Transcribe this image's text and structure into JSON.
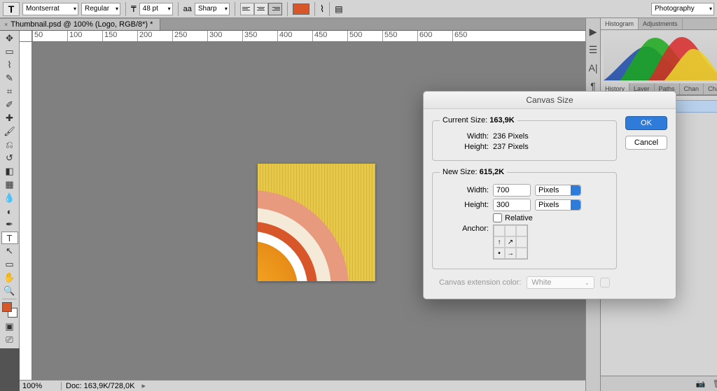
{
  "options_bar": {
    "tool_letter": "T",
    "font_family": "Montserrat",
    "font_style": "Regular",
    "font_size": "48 pt",
    "aa_label": "aa",
    "aa_mode": "Sharp",
    "text_color": "#d8572a",
    "workspace": "Photography"
  },
  "doc_tab": {
    "title": "Thumbnail.psd @ 100% (Logo, RGB/8*) *"
  },
  "ruler_ticks": [
    "50",
    "100",
    "150",
    "200",
    "250",
    "300",
    "350",
    "400",
    "450",
    "500",
    "550",
    "600",
    "650"
  ],
  "status_bar": {
    "zoom": "100%",
    "doc_size": "Doc: 163,9K/728,0K"
  },
  "panels": {
    "hist_tabs": [
      "Histogram",
      "Adjustments"
    ],
    "layer_tabs": [
      "History",
      "Layer",
      "Paths",
      "Chan",
      "Chan"
    ]
  },
  "dialog": {
    "title": "Canvas Size",
    "ok": "OK",
    "cancel": "Cancel",
    "current_label": "Current Size:",
    "current_size": "163,9K",
    "cur_width_label": "Width:",
    "cur_width": "236 Pixels",
    "cur_height_label": "Height:",
    "cur_height": "237 Pixels",
    "new_label": "New Size:",
    "new_size": "615,2K",
    "width_label": "Width:",
    "width_val": "700",
    "height_label": "Height:",
    "height_val": "300",
    "unit": "Pixels",
    "relative": "Relative",
    "anchor_label": "Anchor:",
    "ext_label": "Canvas extension color:",
    "ext_value": "White"
  }
}
